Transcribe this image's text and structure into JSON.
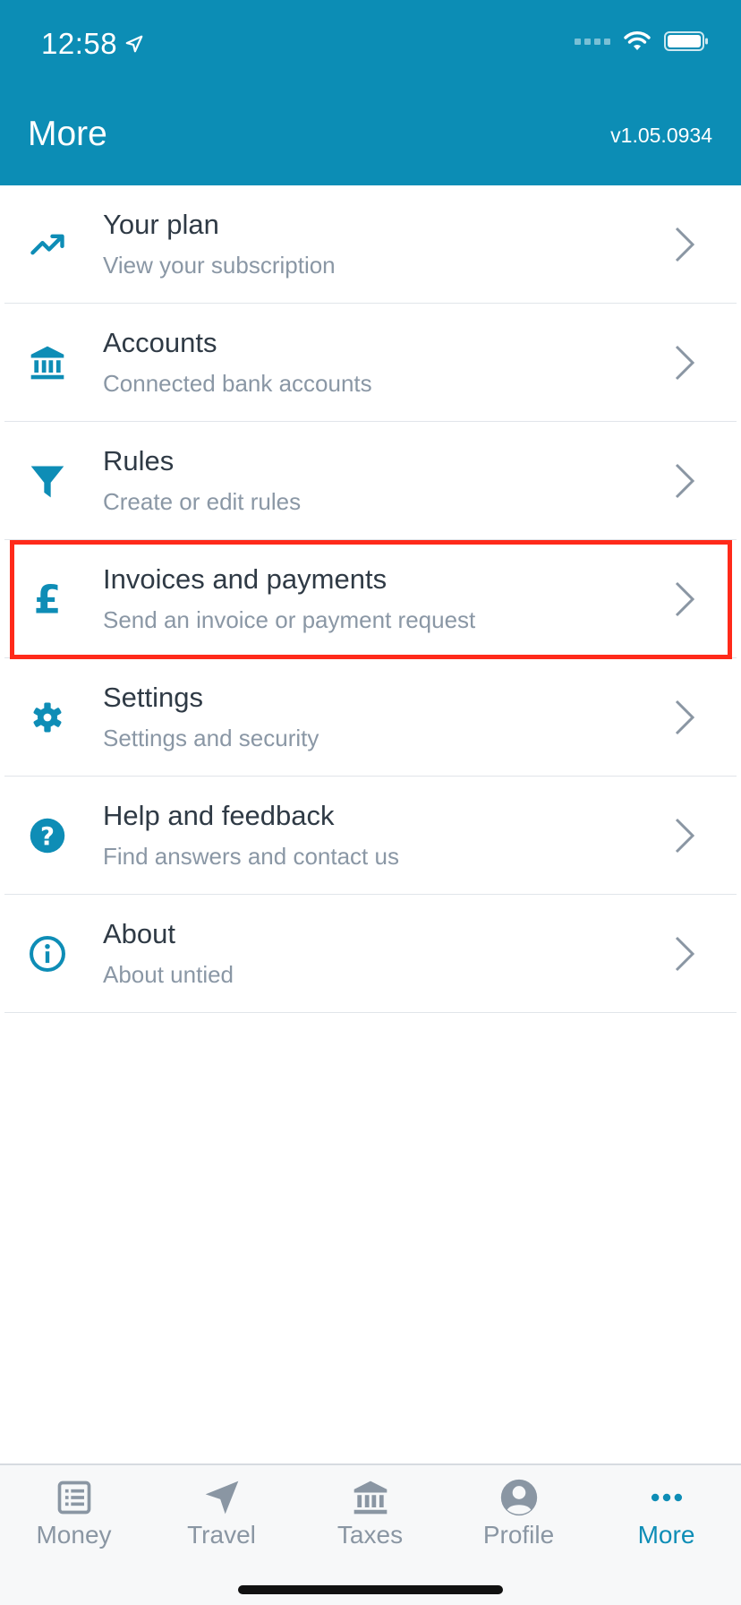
{
  "status_bar": {
    "time": "12:58"
  },
  "header": {
    "title": "More",
    "version": "v1.05.0934"
  },
  "menu": {
    "items": [
      {
        "icon": "trending-up-icon",
        "title": "Your plan",
        "subtitle": "View your subscription"
      },
      {
        "icon": "bank-icon",
        "title": "Accounts",
        "subtitle": "Connected bank accounts"
      },
      {
        "icon": "filter-icon",
        "title": "Rules",
        "subtitle": "Create or edit rules"
      },
      {
        "icon": "pound-icon",
        "title": "Invoices and payments",
        "subtitle": "Send an invoice or payment request"
      },
      {
        "icon": "gear-icon",
        "title": "Settings",
        "subtitle": "Settings and security"
      },
      {
        "icon": "help-icon",
        "title": "Help and feedback",
        "subtitle": "Find answers and contact us"
      },
      {
        "icon": "info-icon",
        "title": "About",
        "subtitle": "About untied"
      }
    ]
  },
  "tabbar": {
    "tabs": [
      {
        "label": "Money",
        "icon": "list-icon",
        "active": false
      },
      {
        "label": "Travel",
        "icon": "navigation-arrow-icon",
        "active": false
      },
      {
        "label": "Taxes",
        "icon": "bank-icon",
        "active": false
      },
      {
        "label": "Profile",
        "icon": "user-circle-icon",
        "active": false
      },
      {
        "label": "More",
        "icon": "more-dots-icon",
        "active": true
      }
    ]
  },
  "colors": {
    "brand": "#0c8db5",
    "highlight": "#ff2a1a",
    "text": "#2f3a45",
    "subtext": "#8a97a5"
  }
}
